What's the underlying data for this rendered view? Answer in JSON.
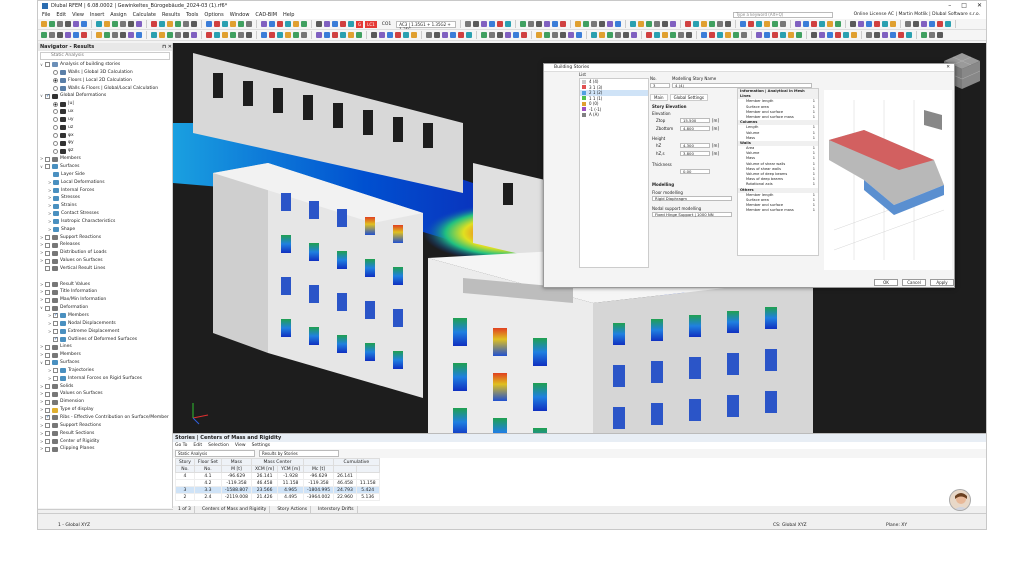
{
  "window": {
    "title": "Dlubal RFEM | 6.08.0002 | Gewinkeltes_Bürogebäude_2024-03 (1).rf6*",
    "search_placeholder": "Type a keyword (Alt+Q)",
    "license": "Online License AC | Martin Motlik | Dlubal Software s.r.o."
  },
  "menu": [
    "File",
    "Edit",
    "View",
    "Insert",
    "Assign",
    "Calculate",
    "Results",
    "Tools",
    "Options",
    "Window",
    "CAD-BIM",
    "Help"
  ],
  "toolbar": {
    "load_case_badge": "G",
    "load_case_code": "LC1",
    "load_case_name": "CO1",
    "combo_text": "AC3 | 1.35G1 + 1.35G2 + 1.35G..."
  },
  "navigator": {
    "title": "Navigator - Results",
    "combo": "Static Analysis",
    "items": [
      {
        "label": "Analysis of building stories",
        "level": 0,
        "exp": "∨",
        "ctrl": "chk",
        "on": false,
        "icon": "#6b8fb8"
      },
      {
        "label": "Walls | Global 3D Calculation",
        "level": 1,
        "exp": "",
        "ctrl": "rad",
        "on": false,
        "icon": "#5a7fa8"
      },
      {
        "label": "Floors | Local 2D Calculation",
        "level": 1,
        "exp": "",
        "ctrl": "rad",
        "on": true,
        "icon": "#5a7fa8"
      },
      {
        "label": "Walls & Floors | Global/Local Calculation",
        "level": 1,
        "exp": "",
        "ctrl": "rad",
        "on": false,
        "icon": "#5a7fa8"
      },
      {
        "label": "Global Deformations",
        "level": 0,
        "exp": "∨",
        "ctrl": "chk",
        "on": true,
        "icon": "#333"
      },
      {
        "label": "|u|",
        "level": 1,
        "exp": "",
        "ctrl": "rad",
        "on": true,
        "icon": "#333"
      },
      {
        "label": "ux",
        "level": 1,
        "exp": "",
        "ctrl": "rad",
        "on": false,
        "icon": "#333"
      },
      {
        "label": "uy",
        "level": 1,
        "exp": "",
        "ctrl": "rad",
        "on": false,
        "icon": "#333"
      },
      {
        "label": "uz",
        "level": 1,
        "exp": "",
        "ctrl": "rad",
        "on": false,
        "icon": "#333"
      },
      {
        "label": "φx",
        "level": 1,
        "exp": "",
        "ctrl": "rad",
        "on": false,
        "icon": "#333"
      },
      {
        "label": "φy",
        "level": 1,
        "exp": "",
        "ctrl": "rad",
        "on": false,
        "icon": "#333"
      },
      {
        "label": "φz",
        "level": 1,
        "exp": "",
        "ctrl": "rad",
        "on": false,
        "icon": "#333"
      },
      {
        "label": "Members",
        "level": 0,
        "exp": ">",
        "ctrl": "chk",
        "on": false,
        "icon": "#777"
      },
      {
        "label": "Surfaces",
        "level": 0,
        "exp": "∨",
        "ctrl": "chk",
        "on": false,
        "icon": "#4a90c0"
      },
      {
        "label": "Layer Side",
        "level": 1,
        "exp": "",
        "ctrl": "",
        "on": false,
        "icon": "#4a90c0"
      },
      {
        "label": "Local Deformations",
        "level": 1,
        "exp": ">",
        "ctrl": "",
        "on": false,
        "icon": "#4a90c0"
      },
      {
        "label": "Internal Forces",
        "level": 1,
        "exp": ">",
        "ctrl": "",
        "on": false,
        "icon": "#4a90c0"
      },
      {
        "label": "Stresses",
        "level": 1,
        "exp": ">",
        "ctrl": "",
        "on": false,
        "icon": "#4a90c0"
      },
      {
        "label": "Strains",
        "level": 1,
        "exp": ">",
        "ctrl": "",
        "on": false,
        "icon": "#4a90c0"
      },
      {
        "label": "Contact Stresses",
        "level": 1,
        "exp": ">",
        "ctrl": "",
        "on": false,
        "icon": "#4a90c0"
      },
      {
        "label": "Isotropic Characteristics",
        "level": 1,
        "exp": ">",
        "ctrl": "",
        "on": false,
        "icon": "#4a90c0"
      },
      {
        "label": "Shape",
        "level": 1,
        "exp": ">",
        "ctrl": "",
        "on": false,
        "icon": "#4a90c0"
      },
      {
        "label": "Support Reactions",
        "level": 0,
        "exp": ">",
        "ctrl": "chk",
        "on": false,
        "icon": "#777"
      },
      {
        "label": "Releases",
        "level": 0,
        "exp": ">",
        "ctrl": "chk",
        "on": false,
        "icon": "#777"
      },
      {
        "label": "Distribution of Loads",
        "level": 0,
        "exp": ">",
        "ctrl": "chk",
        "on": false,
        "icon": "#777"
      },
      {
        "label": "Values on Surfaces",
        "level": 0,
        "exp": ">",
        "ctrl": "chk",
        "on": false,
        "icon": "#777"
      },
      {
        "label": "Vertical Result Lines",
        "level": 0,
        "exp": "",
        "ctrl": "chk",
        "on": false,
        "icon": "#777"
      },
      {
        "label": "",
        "level": 0,
        "exp": "",
        "ctrl": "",
        "on": false,
        "icon": ""
      },
      {
        "label": "Result Values",
        "level": 0,
        "exp": ">",
        "ctrl": "chk",
        "on": false,
        "icon": "#777"
      },
      {
        "label": "Title Information",
        "level": 0,
        "exp": ">",
        "ctrl": "chk",
        "on": false,
        "icon": "#777"
      },
      {
        "label": "Max/Min Information",
        "level": 0,
        "exp": ">",
        "ctrl": "chk",
        "on": false,
        "icon": "#777"
      },
      {
        "label": "Deformation",
        "level": 0,
        "exp": "∨",
        "ctrl": "chk",
        "on": false,
        "icon": "#777"
      },
      {
        "label": "Members",
        "level": 1,
        "exp": ">",
        "ctrl": "chk",
        "on": true,
        "icon": "#4a90c0"
      },
      {
        "label": "Nodal Displacements",
        "level": 1,
        "exp": ">",
        "ctrl": "chk",
        "on": false,
        "icon": "#4a90c0"
      },
      {
        "label": "Extreme Displacement",
        "level": 1,
        "exp": ">",
        "ctrl": "chk",
        "on": false,
        "icon": "#4a90c0"
      },
      {
        "label": "Outlines of Deformed Surfaces",
        "level": 1,
        "exp": "",
        "ctrl": "chk",
        "on": true,
        "icon": "#4a90c0"
      },
      {
        "label": "Lines",
        "level": 0,
        "exp": ">",
        "ctrl": "chk",
        "on": false,
        "icon": "#777"
      },
      {
        "label": "Members",
        "level": 0,
        "exp": ">",
        "ctrl": "chk",
        "on": false,
        "icon": "#777"
      },
      {
        "label": "Surfaces",
        "level": 0,
        "exp": "∨",
        "ctrl": "chk",
        "on": false,
        "icon": "#4a90c0"
      },
      {
        "label": "Trajectories",
        "level": 1,
        "exp": ">",
        "ctrl": "chk",
        "on": false,
        "icon": "#4a90c0"
      },
      {
        "label": "Internal Forces on Rigid Surfaces",
        "level": 1,
        "exp": ">",
        "ctrl": "chk",
        "on": false,
        "icon": "#4a90c0"
      },
      {
        "label": "Solids",
        "level": 0,
        "exp": ">",
        "ctrl": "chk",
        "on": false,
        "icon": "#777"
      },
      {
        "label": "Values on Surfaces",
        "level": 0,
        "exp": ">",
        "ctrl": "chk",
        "on": false,
        "icon": "#777"
      },
      {
        "label": "Dimension",
        "level": 0,
        "exp": ">",
        "ctrl": "chk",
        "on": false,
        "icon": "#777"
      },
      {
        "label": "Type of display",
        "level": 0,
        "exp": ">",
        "ctrl": "chk",
        "on": false,
        "icon": "#e0b030"
      },
      {
        "label": "Ribs - Effective Contribution on Surface/Member",
        "level": 0,
        "exp": ">",
        "ctrl": "chk",
        "on": true,
        "icon": "#777"
      },
      {
        "label": "Support Reactions",
        "level": 0,
        "exp": ">",
        "ctrl": "chk",
        "on": false,
        "icon": "#777"
      },
      {
        "label": "Result Sections",
        "level": 0,
        "exp": ">",
        "ctrl": "chk",
        "on": false,
        "icon": "#777"
      },
      {
        "label": "Center of Rigidity",
        "level": 0,
        "exp": ">",
        "ctrl": "chk",
        "on": false,
        "icon": "#777"
      },
      {
        "label": "Clipping Planes",
        "level": 0,
        "exp": ">",
        "ctrl": "chk",
        "on": false,
        "icon": "#777"
      }
    ]
  },
  "dialog": {
    "title": "Building Stories",
    "list_header": "List",
    "stories": [
      {
        "label": "4 (4)",
        "color": "#c8c8c8"
      },
      {
        "label": "3 1 (3)",
        "color": "#e05050"
      },
      {
        "label": "2 1 (2)",
        "color": "#50a0e0"
      },
      {
        "label": "1 1 (1)",
        "color": "#50c050"
      },
      {
        "label": "0 (0)",
        "color": "#e0a030"
      },
      {
        "label": "-1 (-1)",
        "color": "#a050c0"
      },
      {
        "label": "A (A)",
        "color": "#808080"
      }
    ],
    "no_label": "No.",
    "no_value": "3",
    "name_label": "Modelling Story Name",
    "name_value": "4 (4)",
    "tabs": [
      "Main",
      "Global Settings"
    ],
    "story_elevation": "Story Elevation",
    "elevation": "Elevation",
    "z_top_label": "Ztop",
    "z_top_value": "15.500",
    "z_bot_label": "Zbottom",
    "z_bot_value": "4.800",
    "height": "Height",
    "h_label": "hZ",
    "h_value": "4.300",
    "hs_label": "hZ,s",
    "hs_value": "3.800",
    "thickness": "Thickness",
    "t_value": "0.00",
    "modelling": "Modelling",
    "floor_modelling": "Floor modelling",
    "floor_value": "Rigid Diaphragm",
    "support_label": "Nodal support modelling",
    "support_value": "Fixed Hinge Support | 1000 NN",
    "unit_m": "[m]",
    "info_title": "Information | Analytical in Mesh",
    "info": [
      {
        "h": true,
        "k": "Lines",
        "v": ""
      },
      {
        "h": false,
        "k": "Member length",
        "v": "1"
      },
      {
        "h": false,
        "k": "Surface area",
        "v": "1"
      },
      {
        "h": false,
        "k": "Member and surface",
        "v": "1"
      },
      {
        "h": false,
        "k": "Member and surface mass",
        "v": "1"
      },
      {
        "h": true,
        "k": "Columns",
        "v": ""
      },
      {
        "h": false,
        "k": "Length",
        "v": "1"
      },
      {
        "h": false,
        "k": "Volume",
        "v": "1"
      },
      {
        "h": false,
        "k": "Mass",
        "v": "1"
      },
      {
        "h": true,
        "k": "Walls",
        "v": ""
      },
      {
        "h": false,
        "k": "Area",
        "v": "1"
      },
      {
        "h": false,
        "k": "Volume",
        "v": "1"
      },
      {
        "h": false,
        "k": "Mass",
        "v": "1"
      },
      {
        "h": false,
        "k": "Volume of shear walls",
        "v": "1"
      },
      {
        "h": false,
        "k": "Mass of shear walls",
        "v": "1"
      },
      {
        "h": false,
        "k": "Volume of deep beams",
        "v": "1"
      },
      {
        "h": false,
        "k": "Mass of deep beams",
        "v": "1"
      },
      {
        "h": false,
        "k": "Rotational axis",
        "v": "1"
      },
      {
        "h": true,
        "k": "Others",
        "v": ""
      },
      {
        "h": false,
        "k": "Member length",
        "v": "1"
      },
      {
        "h": false,
        "k": "Surface area",
        "v": "1"
      },
      {
        "h": false,
        "k": "Member and surface",
        "v": "1"
      },
      {
        "h": false,
        "k": "Member and surface mass",
        "v": "1"
      }
    ],
    "btn_ok": "OK",
    "btn_cancel": "Cancel",
    "btn_apply": "Apply"
  },
  "table": {
    "title": "Stories | Centers of Mass and Rigidity",
    "menu": [
      "Go To",
      "Edit",
      "Selection",
      "View",
      "Settings"
    ],
    "analysis": "Static Analysis",
    "results_by": "Results by Stories",
    "headers_top": [
      "Story",
      "Floor Set",
      "Mass",
      "Mass Center",
      "",
      "Cumulative"
    ],
    "headers": [
      "No.",
      "No.",
      "M [t]",
      "XCM [m]",
      "YCM [m]",
      "Mc [t]",
      "",
      ""
    ],
    "rows": [
      [
        "4",
        "4.1",
        "-96.629",
        "26.141",
        "-1.928",
        "-96.629",
        "26.141",
        ""
      ],
      [
        "",
        "4.2",
        "-119.358",
        "46.458",
        "11.158",
        "-119.358",
        "46.458",
        "11.158"
      ],
      [
        "3",
        "3.3",
        "-1588.807",
        "23.566",
        "4.965",
        "-1804.995",
        "24.793",
        "5.424"
      ],
      [
        "2",
        "2.4",
        "-2119.008",
        "21.426",
        "4.495",
        "-3964.002",
        "22.960",
        "5.136"
      ]
    ],
    "pager": "1 of 3",
    "bottom_tabs": [
      "Centers of Mass and Rigidity",
      "Story Actions",
      "Interstory Drifts"
    ]
  },
  "status": {
    "cs": "1 - Global XYZ",
    "cs_right": "CS: Global XYZ",
    "plane": "Plane: XY"
  }
}
